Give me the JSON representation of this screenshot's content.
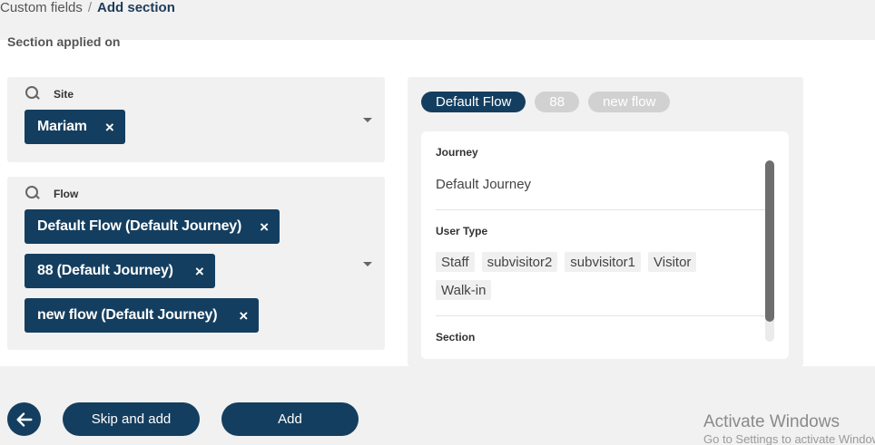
{
  "breadcrumb": {
    "parent": "Custom fields",
    "separator": "/",
    "current": "Add section"
  },
  "section_applied_label": "Section applied on",
  "site_field": {
    "label": "Site",
    "chips": [
      {
        "label": "Mariam",
        "remove": "×"
      }
    ]
  },
  "flow_field": {
    "label": "Flow",
    "chips": [
      {
        "label": "Default Flow (Default Journey)",
        "remove": "×"
      },
      {
        "label": "88 (Default Journey)",
        "remove": "×"
      },
      {
        "label": "new flow (Default Journey)",
        "remove": "×"
      }
    ]
  },
  "preview": {
    "tabs": [
      {
        "label": "Default Flow",
        "active": true
      },
      {
        "label": "88",
        "active": false
      },
      {
        "label": "new flow",
        "active": false
      }
    ],
    "journey_title": "Journey",
    "journey_value": "Default Journey",
    "user_type_title": "User Type",
    "user_types": [
      "Staff",
      "subvisitor2",
      "subvisitor1",
      "Visitor",
      "Walk-in"
    ],
    "section_title": "Section"
  },
  "footer": {
    "skip_label": "Skip and add",
    "add_label": "Add"
  },
  "watermark": {
    "title": "Activate Windows",
    "subtitle": "Go to Settings to activate Windows."
  },
  "colors": {
    "primary": "#143e5f",
    "background": "#f1f1f1",
    "panel": "#ffffff"
  }
}
